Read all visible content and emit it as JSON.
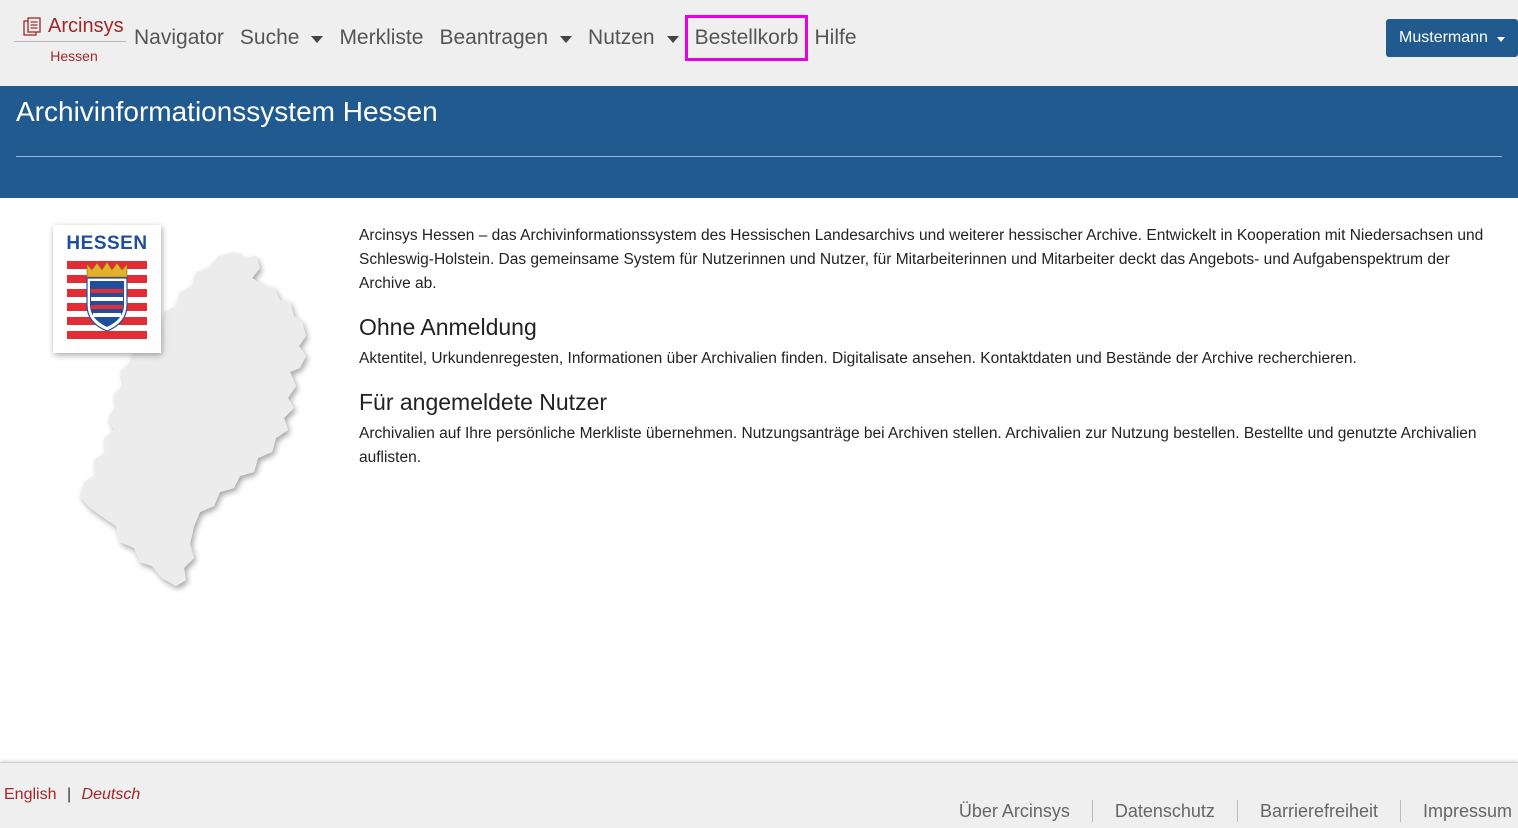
{
  "brand": {
    "name": "Arcinsys",
    "subtitle": "Hessen"
  },
  "nav": {
    "items": [
      {
        "label": "Navigator",
        "dropdown": false
      },
      {
        "label": "Suche",
        "dropdown": true
      },
      {
        "label": "Merkliste",
        "dropdown": false
      },
      {
        "label": "Beantragen",
        "dropdown": true
      },
      {
        "label": "Nutzen",
        "dropdown": true
      },
      {
        "label": "Bestellkorb",
        "dropdown": false,
        "highlighted": true
      },
      {
        "label": "Hilfe",
        "dropdown": false
      }
    ],
    "user_label": "Mustermann"
  },
  "banner": {
    "title": "Archivinformationssystem Hessen"
  },
  "logo": {
    "text": "HESSEN"
  },
  "main": {
    "intro": "Arcinsys Hessen – das Archivinformationssystem des Hessischen Landesarchivs und weiterer hessischer Archive. Entwickelt in Kooperation mit Niedersachsen und Schleswig-Holstein. Das gemeinsame System für Nutzerinnen und Nutzer, für Mitarbeiterinnen und Mitarbeiter deckt das Angebots- und Aufgabenspektrum der Archive ab.",
    "sections": [
      {
        "heading": "Ohne Anmeldung",
        "text": "Aktentitel, Urkundenregesten, Informationen über Archivalien finden. Digitalisate ansehen. Kontaktdaten und Bestände der Archive recherchieren."
      },
      {
        "heading": "Für angemeldete Nutzer",
        "text": "Archivalien auf Ihre persönliche Merkliste übernehmen. Nutzungsanträge bei Archiven stellen. Archivalien zur Nutzung bestellen. Bestellte und genutzte Archivalien auflisten."
      }
    ]
  },
  "footer": {
    "languages": {
      "english": "English",
      "separator": "|",
      "deutsch": "Deutsch"
    },
    "links": [
      "Über Arcinsys",
      "Datenschutz",
      "Barrierefreiheit",
      "Impressum"
    ]
  },
  "colors": {
    "brand_red": "#a3262a",
    "banner_blue": "#205a8e",
    "highlight": "#e600e6"
  }
}
